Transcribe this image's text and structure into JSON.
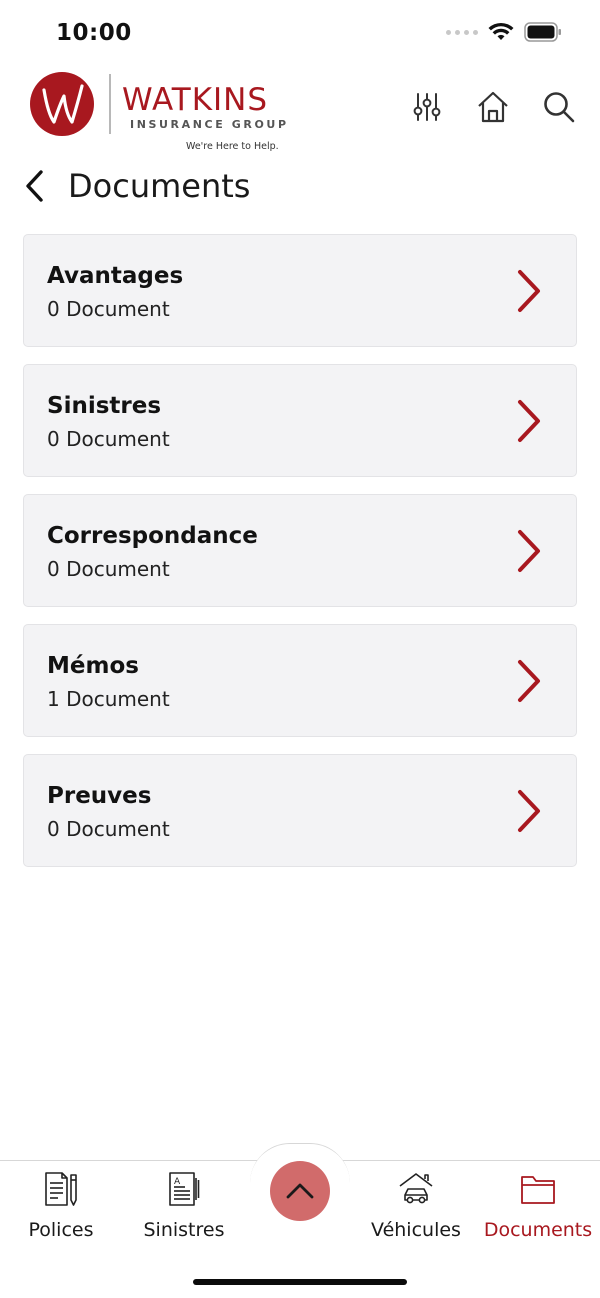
{
  "status_bar": {
    "time": "10:00"
  },
  "brand": {
    "name": "WATKINS",
    "subline": "INSURANCE GROUP",
    "tagline": "We're Here to Help.",
    "accent_color": "#a8181f",
    "logo_monogram": "W"
  },
  "header": {
    "actions": [
      {
        "name": "filter-sliders-icon"
      },
      {
        "name": "home-icon"
      },
      {
        "name": "search-icon"
      }
    ]
  },
  "page": {
    "title": "Documents"
  },
  "documents": [
    {
      "name": "Avantages",
      "count": "0 Document"
    },
    {
      "name": "Sinistres",
      "count": "0 Document"
    },
    {
      "name": "Correspondance",
      "count": "0 Document"
    },
    {
      "name": "Mémos",
      "count": "1 Document"
    },
    {
      "name": "Preuves",
      "count": "0 Document"
    }
  ],
  "tab_bar": {
    "tabs": [
      {
        "label": "Polices",
        "icon": "policy-document-icon",
        "active": false
      },
      {
        "label": "Sinistres",
        "icon": "claims-document-icon",
        "active": false
      },
      {
        "label": "Véhicules",
        "icon": "vehicle-garage-icon",
        "active": false
      },
      {
        "label": "Documents",
        "icon": "folder-icon",
        "active": true
      }
    ],
    "center_button_icon": "chevron-up-icon",
    "center_button_color": "#d16b6b"
  }
}
